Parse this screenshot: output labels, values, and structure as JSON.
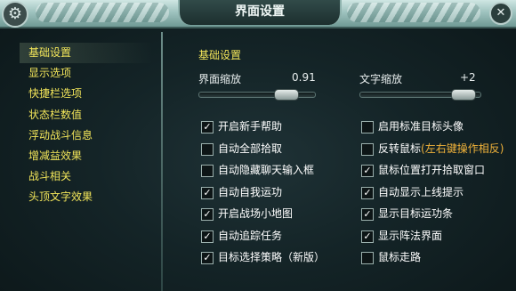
{
  "window": {
    "title": "界面设置"
  },
  "sidebar": {
    "items": [
      {
        "label": "基础设置"
      },
      {
        "label": "显示选项"
      },
      {
        "label": "快捷栏选项"
      },
      {
        "label": "状态栏数值"
      },
      {
        "label": "浮动战斗信息"
      },
      {
        "label": "增减益效果"
      },
      {
        "label": "战斗相关"
      },
      {
        "label": "头顶文字效果"
      }
    ],
    "active_index": 0
  },
  "main": {
    "section_title": "基础设置",
    "ui_scale": {
      "label": "界面缩放",
      "value": "0.91",
      "level": 0.82
    },
    "text_scale": {
      "label": "文字缩放",
      "value": "+2",
      "level": 0.95
    },
    "left_options": [
      {
        "label": "开启新手帮助",
        "checked": true
      },
      {
        "label": "自动全部拾取",
        "checked": false
      },
      {
        "label": "自动隐藏聊天输入框",
        "checked": false
      },
      {
        "label": "自动自我运功",
        "checked": true
      },
      {
        "label": "开启战场小地图",
        "checked": true
      },
      {
        "label": "自动追踪任务",
        "checked": true
      },
      {
        "label": "目标选择策略（新版）",
        "checked": true
      }
    ],
    "right_options": [
      {
        "label": "启用标准目标头像",
        "checked": false,
        "note": ""
      },
      {
        "label": "反转鼠标",
        "checked": false,
        "note": "(左右键操作相反)"
      },
      {
        "label": "鼠标位置打开拾取窗口",
        "checked": true,
        "note": ""
      },
      {
        "label": "自动显示上线提示",
        "checked": true,
        "note": ""
      },
      {
        "label": "显示目标运功条",
        "checked": true,
        "note": ""
      },
      {
        "label": "显示阵法界面",
        "checked": true,
        "note": ""
      },
      {
        "label": "鼠标走路",
        "checked": false,
        "note": ""
      }
    ]
  },
  "colors": {
    "nav_text": "#f3e65a",
    "note_text": "#f0b23a",
    "option_text": "#ffffff"
  },
  "icons": {
    "settings": "gear-icon",
    "close": "close-icon",
    "check": "checkmark-icon"
  }
}
